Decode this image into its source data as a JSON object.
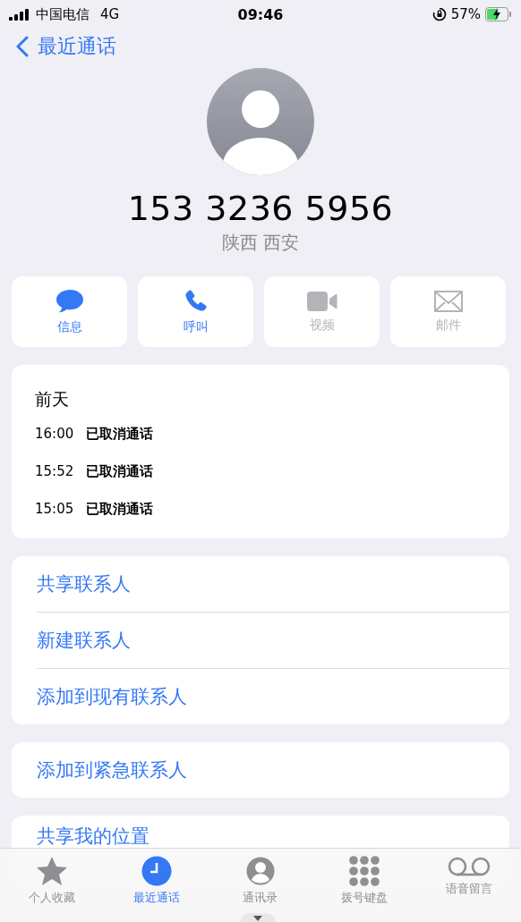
{
  "status_bar": {
    "carrier": "中国电信",
    "network": "4G",
    "time": "09:46",
    "battery": "57%"
  },
  "nav": {
    "back": "最近通话"
  },
  "contact": {
    "number": "153 3236 5956",
    "location": "陕西 西安"
  },
  "actions": [
    {
      "kind": "message",
      "label": "信息",
      "disabled": false
    },
    {
      "kind": "call",
      "label": "呼叫",
      "disabled": false
    },
    {
      "kind": "video",
      "label": "视频",
      "disabled": true
    },
    {
      "kind": "mail",
      "label": "邮件",
      "disabled": true
    }
  ],
  "history": {
    "date": "前天",
    "calls": [
      {
        "time": "16:00",
        "status": "已取消通话"
      },
      {
        "time": "15:52",
        "status": "已取消通话"
      },
      {
        "time": "15:05",
        "status": "已取消通话"
      }
    ]
  },
  "option_groups": [
    [
      "共享联系人",
      "新建联系人",
      "添加到现有联系人"
    ],
    [
      "添加到紧急联系人"
    ],
    [
      "共享我的位置"
    ]
  ],
  "tab_bar": [
    {
      "kind": "favorites",
      "label": "个人收藏",
      "selected": false
    },
    {
      "kind": "recents",
      "label": "最近通话",
      "selected": true
    },
    {
      "kind": "contacts",
      "label": "通讯录",
      "selected": false
    },
    {
      "kind": "keypad",
      "label": "拨号键盘",
      "selected": false
    },
    {
      "kind": "voicemail",
      "label": "语音留言",
      "selected": false
    }
  ]
}
